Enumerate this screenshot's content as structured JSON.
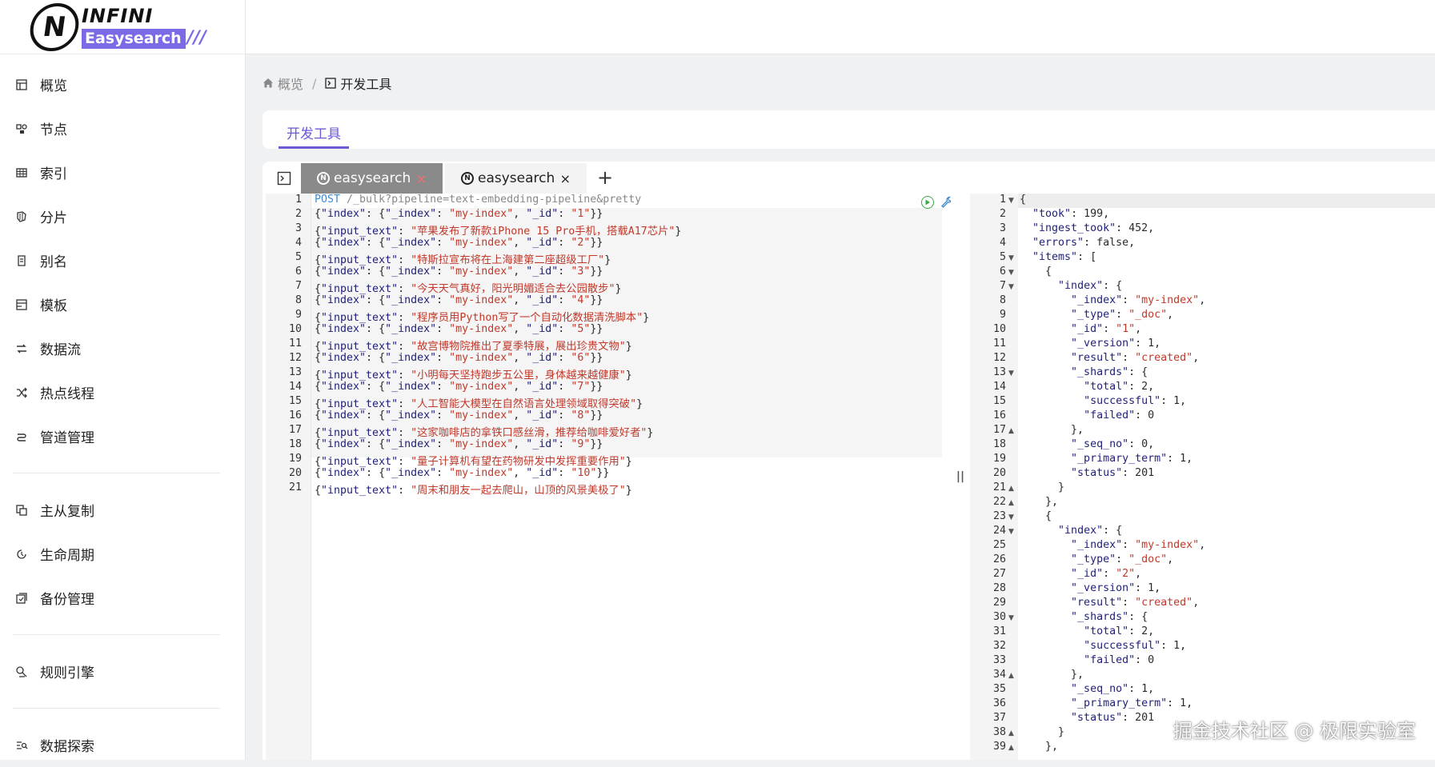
{
  "brand": {
    "top": "INFINI",
    "bottom": "Easysearch",
    "slashes": "///",
    "mark": "N"
  },
  "sidebar": {
    "items": [
      {
        "label": "概览",
        "icon": "dashboard-icon"
      },
      {
        "label": "节点",
        "icon": "nodes-icon"
      },
      {
        "label": "索引",
        "icon": "table-icon"
      },
      {
        "label": "分片",
        "icon": "shards-icon"
      },
      {
        "label": "别名",
        "icon": "alias-icon"
      },
      {
        "label": "模板",
        "icon": "template-icon"
      },
      {
        "label": "数据流",
        "icon": "data-stream-icon"
      },
      {
        "label": "热点线程",
        "icon": "shuffle-icon"
      },
      {
        "label": "管道管理",
        "icon": "pipeline-icon"
      }
    ],
    "group2": [
      {
        "label": "主从复制",
        "icon": "replication-icon"
      },
      {
        "label": "生命周期",
        "icon": "lifecycle-icon"
      },
      {
        "label": "备份管理",
        "icon": "backup-icon"
      }
    ],
    "group3": [
      {
        "label": "规则引擎",
        "icon": "rule-engine-icon"
      }
    ],
    "group4": [
      {
        "label": "数据探索",
        "icon": "data-explore-icon"
      }
    ]
  },
  "breadcrumb": {
    "home": "概览",
    "separator": "/",
    "current": "开发工具"
  },
  "page_tab": "开发工具",
  "editor_tabs": [
    {
      "label": "easysearch",
      "active": true,
      "close": "×"
    },
    {
      "label": "easysearch",
      "active": false,
      "close": "×"
    }
  ],
  "add_tab": "+",
  "request": {
    "lines": [
      "POST /_bulk?pipeline=text-embedding-pipeline&pretty",
      "{\"index\": {\"_index\": \"my-index\", \"_id\": \"1\"}}",
      "{\"input_text\": \"苹果发布了新款iPhone 15 Pro手机，搭载A17芯片\"}",
      "{\"index\": {\"_index\": \"my-index\", \"_id\": \"2\"}}",
      "{\"input_text\": \"特斯拉宣布将在上海建第二座超级工厂\"}",
      "{\"index\": {\"_index\": \"my-index\", \"_id\": \"3\"}}",
      "{\"input_text\": \"今天天气真好，阳光明媚适合去公园散步\"}",
      "{\"index\": {\"_index\": \"my-index\", \"_id\": \"4\"}}",
      "{\"input_text\": \"程序员用Python写了一个自动化数据清洗脚本\"}",
      "{\"index\": {\"_index\": \"my-index\", \"_id\": \"5\"}}",
      "{\"input_text\": \"故宫博物院推出了夏季特展，展出珍贵文物\"}",
      "{\"index\": {\"_index\": \"my-index\", \"_id\": \"6\"}}",
      "{\"input_text\": \"小明每天坚持跑步五公里，身体越来越健康\"}",
      "{\"index\": {\"_index\": \"my-index\", \"_id\": \"7\"}}",
      "{\"input_text\": \"人工智能大模型在自然语言处理领域取得突破\"}",
      "{\"index\": {\"_index\": \"my-index\", \"_id\": \"8\"}}",
      "{\"input_text\": \"这家咖啡店的拿铁口感丝滑，推荐给咖啡爱好者\"}",
      "{\"index\": {\"_index\": \"my-index\", \"_id\": \"9\"}}",
      "{\"input_text\": \"量子计算机有望在药物研发中发挥重要作用\"}",
      "{\"index\": {\"_index\": \"my-index\", \"_id\": \"10\"}}",
      "{\"input_text\": \"周末和朋友一起去爬山，山顶的风景美极了\"}"
    ]
  },
  "response": {
    "lines": [
      {
        "text": "{",
        "fold": "open"
      },
      {
        "text": "  \"took\": 199,",
        "fold": ""
      },
      {
        "text": "  \"ingest_took\": 452,",
        "fold": ""
      },
      {
        "text": "  \"errors\": false,",
        "fold": ""
      },
      {
        "text": "  \"items\": [",
        "fold": "open"
      },
      {
        "text": "    {",
        "fold": "open"
      },
      {
        "text": "      \"index\": {",
        "fold": "open"
      },
      {
        "text": "        \"_index\": \"my-index\",",
        "fold": ""
      },
      {
        "text": "        \"_type\": \"_doc\",",
        "fold": ""
      },
      {
        "text": "        \"_id\": \"1\",",
        "fold": ""
      },
      {
        "text": "        \"_version\": 1,",
        "fold": ""
      },
      {
        "text": "        \"result\": \"created\",",
        "fold": ""
      },
      {
        "text": "        \"_shards\": {",
        "fold": "open"
      },
      {
        "text": "          \"total\": 2,",
        "fold": ""
      },
      {
        "text": "          \"successful\": 1,",
        "fold": ""
      },
      {
        "text": "          \"failed\": 0",
        "fold": ""
      },
      {
        "text": "        },",
        "fold": "close"
      },
      {
        "text": "        \"_seq_no\": 0,",
        "fold": ""
      },
      {
        "text": "        \"_primary_term\": 1,",
        "fold": ""
      },
      {
        "text": "        \"status\": 201",
        "fold": ""
      },
      {
        "text": "      }",
        "fold": "close"
      },
      {
        "text": "    },",
        "fold": "close"
      },
      {
        "text": "    {",
        "fold": "open"
      },
      {
        "text": "      \"index\": {",
        "fold": "open"
      },
      {
        "text": "        \"_index\": \"my-index\",",
        "fold": ""
      },
      {
        "text": "        \"_type\": \"_doc\",",
        "fold": ""
      },
      {
        "text": "        \"_id\": \"2\",",
        "fold": ""
      },
      {
        "text": "        \"_version\": 1,",
        "fold": ""
      },
      {
        "text": "        \"result\": \"created\",",
        "fold": ""
      },
      {
        "text": "        \"_shards\": {",
        "fold": "open"
      },
      {
        "text": "          \"total\": 2,",
        "fold": ""
      },
      {
        "text": "          \"successful\": 1,",
        "fold": ""
      },
      {
        "text": "          \"failed\": 0",
        "fold": ""
      },
      {
        "text": "        },",
        "fold": "close"
      },
      {
        "text": "        \"_seq_no\": 1,",
        "fold": ""
      },
      {
        "text": "        \"_primary_term\": 1,",
        "fold": ""
      },
      {
        "text": "        \"status\": 201",
        "fold": ""
      },
      {
        "text": "      }",
        "fold": "close"
      },
      {
        "text": "    },",
        "fold": "close"
      }
    ]
  },
  "watermark": "掘金技术社区 @ 极限实验室",
  "colors": {
    "accent": "#6a5ad6",
    "string": "#c0392b",
    "property": "#1f1f7a",
    "method": "#3b8bd8"
  }
}
